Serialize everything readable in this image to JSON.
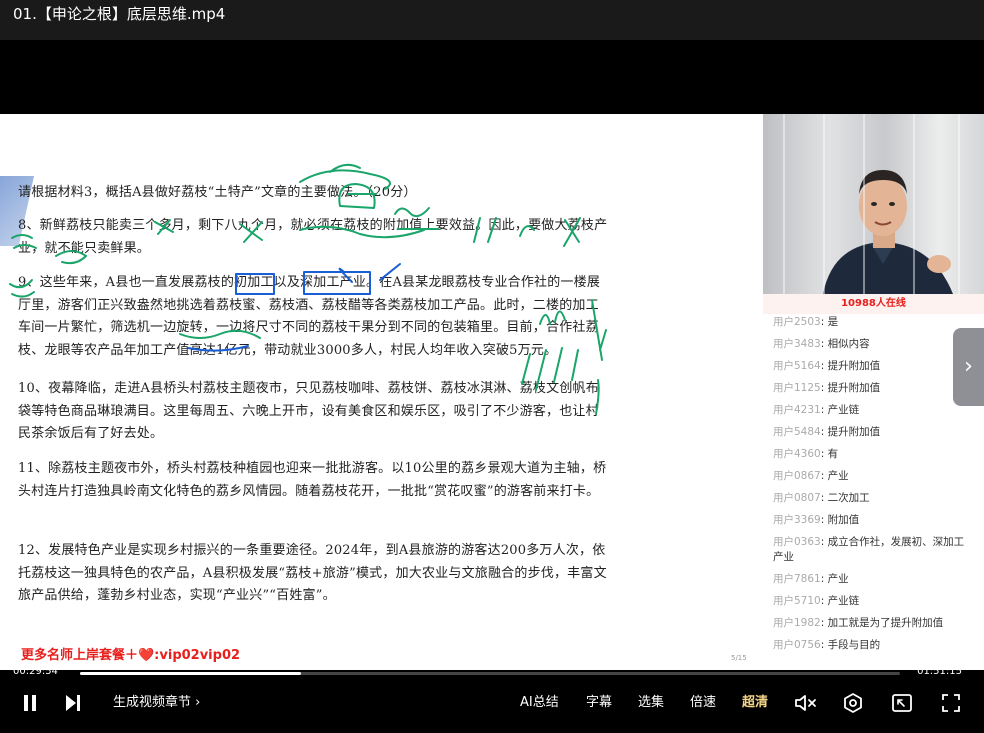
{
  "title": "01.【申论之根】底层思维.mp4",
  "slide": {
    "question": "请根据材料3，概括A县做好荔枝“土特产”文章的主要做法。（20分）",
    "paragraphs": [
      "8、新鲜荔枝只能卖三个多月，剩下八九个月，就必须在荔枝的附加值上要效益。因此，要做大荔枝产业，就不能只卖鲜果。",
      "9、这些年来，A县也一直发展荔枝的初加工以及深加工产业。在A县某龙眼荔枝专业合作社的一楼展厅里，游客们正兴致盎然地挑选着荔枝蜜、荔枝酒、荔枝醋等各类荔枝加工产品。此时，二楼的加工车间一片繁忙，筛选机一边旋转，一边将尺寸不同的荔枝干果分到不同的包装箱里。目前，合作社荔枝、龙眼等农产品年加工产值高达1亿元，带动就业3000多人，村民人均年收入突破5万元。",
      "10、夜幕降临，走进A县桥头村荔枝主题夜市，只见荔枝咖啡、荔枝饼、荔枝冰淇淋、荔枝文创帆布袋等特色商品琳琅满目。这里每周五、六晚上开市，设有美食区和娱乐区，吸引了不少游客，也让村民茶余饭后有了好去处。",
      "11、除荔枝主题夜市外，桥头村荔枝种植园也迎来一批批游客。以10公里的荔乡景观大道为主轴，桥头村连片打造独具岭南文化特色的荔乡风情园。随着荔枝花开，一批批“赏花叹蜜”的游客前来打卡。",
      "12、发展特色产业是实现乡村振兴的一条重要途径。2024年，到A县旅游的游客达200多万人次，依托荔枝这一独具特色的农产品，A县积极发展“荔枝+旅游”模式，加大农业与文旅融合的步伐，丰富文旅产品供给，蓬勃乡村业态，实现“产业兴”“百姓富”。"
    ],
    "promo": "更多名师上岸套餐＋❤️:vip02vip02",
    "page_number": "5/15"
  },
  "online_count": "10988人在线",
  "chat": [
    {
      "user": "用户2503",
      "msg": "是"
    },
    {
      "user": "用户3483",
      "msg": "相似内容"
    },
    {
      "user": "用户5164",
      "msg": "提升附加值"
    },
    {
      "user": "用户1125",
      "msg": "提升附加值"
    },
    {
      "user": "用户4231",
      "msg": "产业链"
    },
    {
      "user": "用户5484",
      "msg": "提升附加值"
    },
    {
      "user": "用户4360",
      "msg": "有"
    },
    {
      "user": "用户0867",
      "msg": "产业"
    },
    {
      "user": "用户0807",
      "msg": "二次加工"
    },
    {
      "user": "用户3369",
      "msg": "附加值"
    },
    {
      "user": "用户0363",
      "msg": "成立合作社，发展初、深加工产业"
    },
    {
      "user": "用户7861",
      "msg": "产业"
    },
    {
      "user": "用户5710",
      "msg": "产业链"
    },
    {
      "user": "用户1982",
      "msg": "加工就是为了提升附加值"
    },
    {
      "user": "用户0756",
      "msg": "手段与目的"
    }
  ],
  "player": {
    "current_time": "00:29:54",
    "total_time": "01:51:15",
    "progress": 0.269,
    "chapter_label": "生成视频章节",
    "ai_summary": "AI总结",
    "subtitles": "字幕",
    "episodes": "选集",
    "speed": "倍速",
    "quality": "超清"
  },
  "colors": {
    "promo_red": "#e8201d",
    "annotation_blue": "#1a5fd6",
    "annotation_green": "#1aa56a",
    "quality_gold": "#f5d68a"
  },
  "icons": {
    "play": "pause-icon",
    "next": "next-icon",
    "mute": "mute-icon",
    "settings": "settings-icon",
    "pip": "picture-in-picture-icon",
    "fullscreen": "fullscreen-icon"
  }
}
